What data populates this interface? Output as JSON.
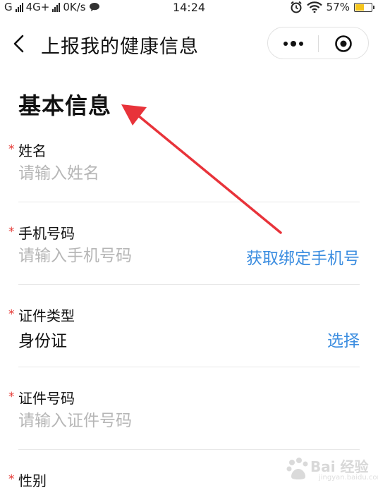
{
  "status_bar": {
    "carrier1": "G",
    "carrier2": "4G+",
    "speed": "0K/s",
    "time": "14:24",
    "battery": "57%",
    "battery_level": 0.57,
    "battery_color": "#f5c51b"
  },
  "nav": {
    "title": "上报我的健康信息",
    "back_icon": "chevron-left-icon",
    "more_icon": "more-dots-icon",
    "close_icon": "target-circle-icon"
  },
  "form": {
    "section_title": "基本信息",
    "required_mark": "*",
    "fields": [
      {
        "label": "姓名",
        "placeholder": "请输入姓名"
      },
      {
        "label": "手机号码",
        "placeholder": "请输入手机号码",
        "action": "获取绑定手机号"
      },
      {
        "label": "证件类型",
        "value": "身份证",
        "action": "选择"
      },
      {
        "label": "证件号码",
        "placeholder": "请输入证件号码"
      },
      {
        "label": "性别"
      }
    ]
  },
  "annotation": {
    "arrow_color": "#e8333a"
  },
  "watermark": {
    "text": "Bai 经验",
    "sub": "jingyan.baidu.com"
  },
  "colors": {
    "accent": "#3b8de0",
    "required": "#e53935",
    "placeholder": "#b6b6b6"
  }
}
